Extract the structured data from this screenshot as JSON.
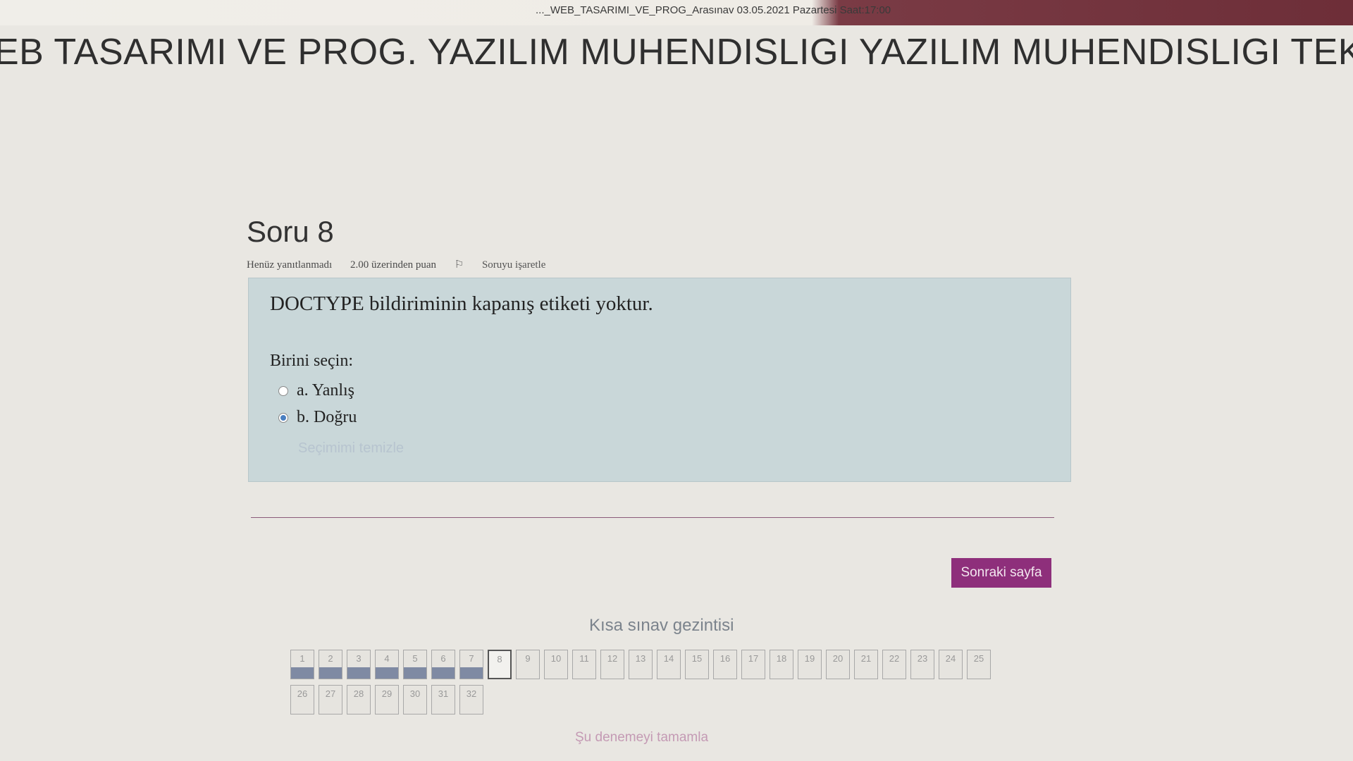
{
  "top_bar": {
    "breadcrumb": "..._WEB_TASARIMI_VE_PROG_Arasınav 03.05.2021 Pazartesi Saat:17:00"
  },
  "course_title": "EB TASARIMI VE PROG. YAZILIM MUHENDISLIGI YAZILIM MUHENDISLIGI TEKNOL",
  "question": {
    "heading": "Soru 8",
    "status": "Henüz yanıtlanmadı",
    "points": "2.00 üzerinden puan",
    "flag_label": "Soruyu işaretle",
    "text": "DOCTYPE bildiriminin kapanış etiketi yoktur.",
    "prompt": "Birini seçin:",
    "options": [
      {
        "label": "a. Yanlış",
        "selected": false
      },
      {
        "label": "b. Doğru",
        "selected": true
      }
    ],
    "clear_label": "Seçimimi temizle"
  },
  "next_button": "Sonraki sayfa",
  "quiz_nav": {
    "title": "Kısa sınav gezintisi",
    "row1": [
      {
        "n": "1",
        "state": "answered"
      },
      {
        "n": "2",
        "state": "answered"
      },
      {
        "n": "3",
        "state": "answered"
      },
      {
        "n": "4",
        "state": "answered"
      },
      {
        "n": "5",
        "state": "answered"
      },
      {
        "n": "6",
        "state": "answered"
      },
      {
        "n": "7",
        "state": "answered"
      },
      {
        "n": "8",
        "state": "current"
      },
      {
        "n": "9",
        "state": "empty"
      },
      {
        "n": "10",
        "state": "empty"
      },
      {
        "n": "11",
        "state": "empty"
      },
      {
        "n": "12",
        "state": "empty"
      },
      {
        "n": "13",
        "state": "empty"
      },
      {
        "n": "14",
        "state": "empty"
      },
      {
        "n": "15",
        "state": "empty"
      },
      {
        "n": "16",
        "state": "empty"
      },
      {
        "n": "17",
        "state": "empty"
      },
      {
        "n": "18",
        "state": "empty"
      },
      {
        "n": "19",
        "state": "empty"
      },
      {
        "n": "20",
        "state": "empty"
      },
      {
        "n": "21",
        "state": "empty"
      },
      {
        "n": "22",
        "state": "empty"
      },
      {
        "n": "23",
        "state": "empty"
      },
      {
        "n": "24",
        "state": "empty"
      },
      {
        "n": "25",
        "state": "empty"
      }
    ],
    "row2": [
      {
        "n": "26",
        "state": "empty"
      },
      {
        "n": "27",
        "state": "empty"
      },
      {
        "n": "28",
        "state": "empty"
      },
      {
        "n": "29",
        "state": "empty"
      },
      {
        "n": "30",
        "state": "empty"
      },
      {
        "n": "31",
        "state": "empty"
      },
      {
        "n": "32",
        "state": "empty"
      }
    ],
    "finish_label": "Şu denemeyi tamamla"
  },
  "colors": {
    "accent_button": "#8e2f7b",
    "question_box": "#c9d7d9",
    "answered_bar": "#7f8aa3"
  }
}
